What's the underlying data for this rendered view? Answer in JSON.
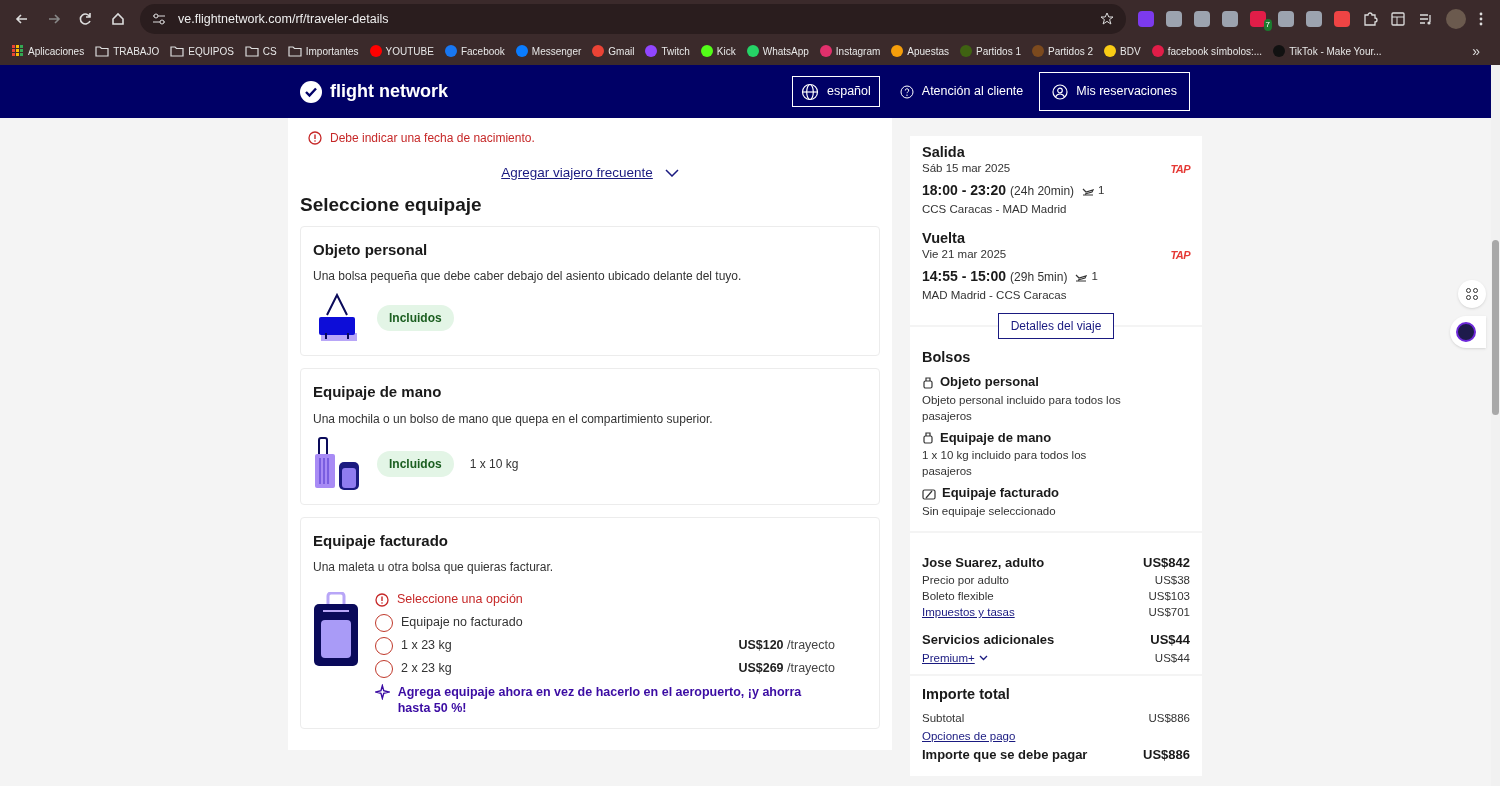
{
  "browser": {
    "url": "ve.flightnetwork.com/rf/traveler-details",
    "extension_badge": "7",
    "bookmarks": [
      {
        "label": "Aplicaciones",
        "kind": "apps"
      },
      {
        "label": "TRABAJO",
        "kind": "folder"
      },
      {
        "label": "EQUIPOS",
        "kind": "folder"
      },
      {
        "label": "CS",
        "kind": "folder"
      },
      {
        "label": "Importantes",
        "kind": "folder"
      },
      {
        "label": "YOUTUBE",
        "kind": "site",
        "color": "#ff0000"
      },
      {
        "label": "Facebook",
        "kind": "site",
        "color": "#1877f2"
      },
      {
        "label": "Messenger",
        "kind": "site",
        "color": "#0a7cff"
      },
      {
        "label": "Gmail",
        "kind": "site",
        "color": "#ea4335"
      },
      {
        "label": "Twitch",
        "kind": "site",
        "color": "#9146ff"
      },
      {
        "label": "Kick",
        "kind": "site",
        "color": "#53fc18"
      },
      {
        "label": "WhatsApp",
        "kind": "site",
        "color": "#25d366"
      },
      {
        "label": "Instagram",
        "kind": "site",
        "color": "#e1306c"
      },
      {
        "label": "Apuestas",
        "kind": "site",
        "color": "#f59e0b"
      },
      {
        "label": "Partidos 1",
        "kind": "site",
        "color": "#3f6212"
      },
      {
        "label": "Partidos 2",
        "kind": "site",
        "color": "#7c4a1e"
      },
      {
        "label": "BDV",
        "kind": "site",
        "color": "#facc15"
      },
      {
        "label": "facebook símbolos:...",
        "kind": "site",
        "color": "#e11d48"
      },
      {
        "label": "TikTok - Make Your...",
        "kind": "site",
        "color": "#111111"
      }
    ],
    "more": "»"
  },
  "header": {
    "brand": "flight network",
    "language": "español",
    "support": "Atención al cliente",
    "bookings": "Mis reservaciones"
  },
  "traveler": {
    "error": "Debe indicar una fecha de nacimiento.",
    "frequent_flyer_link": "Agregar viajero frecuente"
  },
  "baggage": {
    "title": "Seleccione equipaje",
    "cards": [
      {
        "kind": "personal",
        "title": "Objeto personal",
        "description": "Una bolsa pequeña que debe caber debajo del asiento ubicado delante del tuyo.",
        "badge": "Incluidos"
      },
      {
        "kind": "carry",
        "title": "Equipaje de mano",
        "description": "Una mochila o un bolso de mano que quepa en el compartimiento superior.",
        "badge": "Incluidos",
        "allowance": "1 x 10 kg"
      },
      {
        "kind": "checked",
        "title": "Equipaje facturado",
        "description": "Una maleta u otra bolsa que quieras facturar.",
        "error": "Seleccione una opción",
        "options": [
          {
            "label": "Equipaje no facturado",
            "selected": false
          },
          {
            "label": "1 x 23 kg",
            "price": "US$120",
            "unit": "/trayecto",
            "selected": false
          },
          {
            "label": "2 x 23 kg",
            "price": "US$269",
            "unit": "/trayecto",
            "selected": false
          }
        ],
        "promo": "Agrega equipaje ahora en vez de hacerlo en el aeropuerto, ¡y ahorra hasta 50 %!"
      }
    ]
  },
  "order": {
    "flights": [
      {
        "title": "Salida",
        "date": "Sáb 15 mar 2025",
        "times": "18:00 - 23:20",
        "duration": "(24h 20min)",
        "stops": "1",
        "route": "CCS Caracas - MAD Madrid",
        "airline": "TAP"
      },
      {
        "title": "Vuelta",
        "date": "Vie 21 mar 2025",
        "times": "14:55 - 15:00",
        "duration": "(29h 5min)",
        "stops": "1",
        "route": "MAD Madrid - CCS Caracas",
        "airline": "TAP"
      }
    ],
    "details_button": "Detalles del viaje",
    "bags_title": "Bolsos",
    "bags": [
      {
        "kind": "personal",
        "title": "Objeto personal",
        "text": "Objeto personal incluido para todos los pasajeros"
      },
      {
        "kind": "carry",
        "title": "Equipaje de mano",
        "text": "1 x 10 kg incluido para todos los pasajeros"
      },
      {
        "kind": "checked",
        "title": "Equipaje facturado",
        "text": "Sin equipaje seleccionado"
      }
    ],
    "price_groups": [
      {
        "title": "Jose Suarez, adulto",
        "total": "US$842",
        "lines": [
          {
            "label": "Precio por adulto",
            "amount": "US$38",
            "kind": "text"
          },
          {
            "label": "Boleto flexible",
            "amount": "US$103",
            "kind": "text"
          },
          {
            "label": "Impuestos y tasas",
            "amount": "US$701",
            "kind": "link"
          }
        ]
      },
      {
        "title": "Servicios adicionales",
        "total": "US$44",
        "lines": [
          {
            "label": "Premium+",
            "amount": "US$44",
            "kind": "expand"
          }
        ]
      }
    ],
    "total": {
      "title": "Importe total",
      "subtotal_label": "Subtotal",
      "subtotal": "US$886",
      "payment_link": "Opciones de pago",
      "due_label": "Importe que se debe pagar",
      "due": "US$886"
    }
  }
}
